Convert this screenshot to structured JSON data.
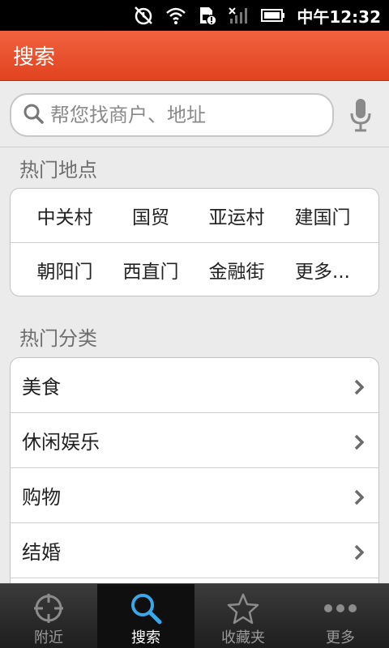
{
  "status_bar": {
    "time": "中午12:32",
    "icons": [
      "alarm-icon",
      "wifi-icon",
      "sim-alert-icon",
      "signal-icon",
      "battery-icon"
    ]
  },
  "header": {
    "title": "搜索"
  },
  "search": {
    "placeholder": "帮您找商户、地址"
  },
  "hot_places": {
    "title": "热门地点",
    "items": [
      "中关村",
      "国贸",
      "亚运村",
      "建国门",
      "朝阳门",
      "西直门",
      "金融街",
      "更多..."
    ]
  },
  "hot_categories": {
    "title": "热门分类",
    "items": [
      "美食",
      "休闲娱乐",
      "购物",
      "结婚"
    ]
  },
  "bottom_nav": {
    "items": [
      {
        "label": "附近",
        "icon": "crosshair-icon"
      },
      {
        "label": "搜索",
        "icon": "search-icon"
      },
      {
        "label": "收藏夹",
        "icon": "star-icon"
      },
      {
        "label": "更多",
        "icon": "more-dots-icon"
      }
    ],
    "active_index": 1
  },
  "colors": {
    "header_bg": "#e8502c",
    "active_icon": "#3aa7e8",
    "page_bg": "#ebebeb"
  }
}
